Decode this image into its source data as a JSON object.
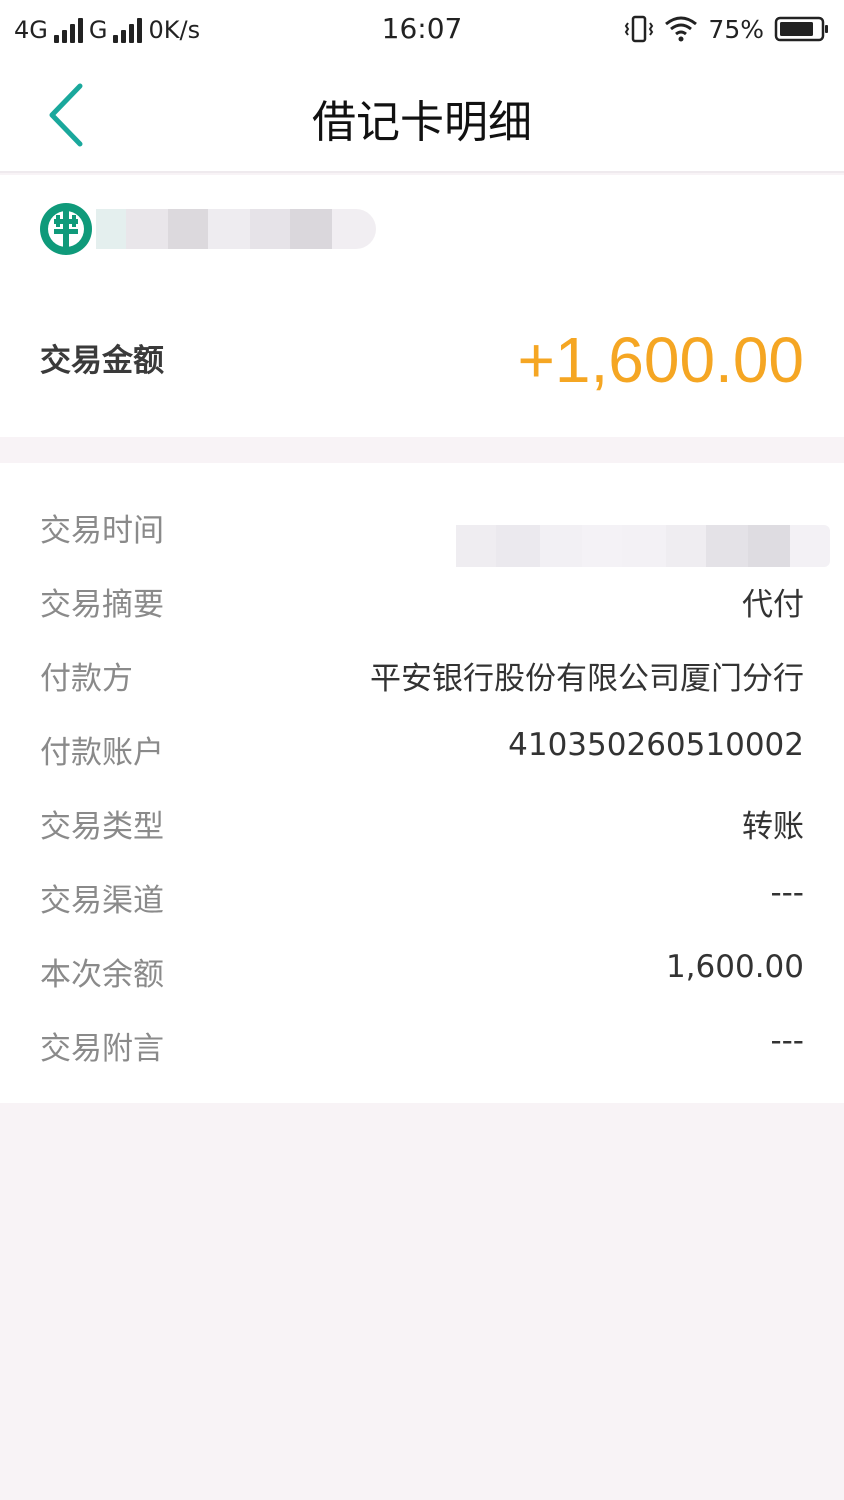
{
  "status_bar": {
    "network1": "4G",
    "network2": "G",
    "speed": "0K/s",
    "time": "16:07",
    "battery": "75%"
  },
  "nav": {
    "title": "借记卡明细",
    "back_icon": "chevron-left-icon"
  },
  "account": {
    "logo_icon": "abc-bank-logo"
  },
  "amount": {
    "label": "交易金额",
    "value": "+1,600.00"
  },
  "details": [
    {
      "label": "交易时间",
      "value": ""
    },
    {
      "label": "交易摘要",
      "value": "代付"
    },
    {
      "label": "付款方",
      "value": "平安银行股份有限公司厦门分行"
    },
    {
      "label": "付款账户",
      "value": "410350260510002"
    },
    {
      "label": "交易类型",
      "value": "转账"
    },
    {
      "label": "交易渠道",
      "value": "---"
    },
    {
      "label": "本次余额",
      "value": "1,600.00"
    },
    {
      "label": "交易附言",
      "value": "---"
    }
  ],
  "colors": {
    "accent_teal": "#1aa89c",
    "amount_orange": "#f5a623",
    "page_bg": "#f8f3f6"
  }
}
